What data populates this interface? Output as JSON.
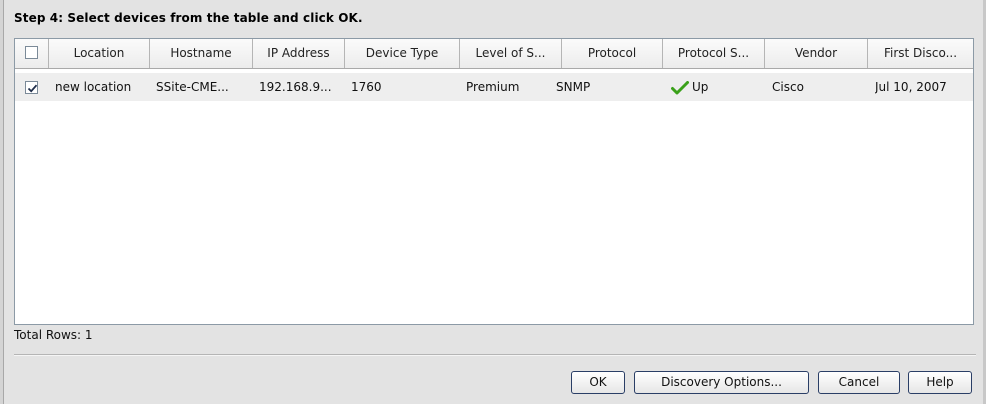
{
  "step_title": "Step 4: Select devices from the table and click OK.",
  "table": {
    "columns": [
      "Location",
      "Hostname",
      "IP Address",
      "Device Type",
      "Level of S...",
      "Protocol",
      "Protocol S...",
      "Vendor",
      "First Disco..."
    ],
    "rows": [
      {
        "checked": true,
        "location": "new location",
        "hostname": "SSite-CME...",
        "ip_address": "192.168.9...",
        "device_type": "1760",
        "level_of_service": "Premium",
        "protocol": "SNMP",
        "protocol_status": "Up",
        "protocol_status_icon": "check-icon",
        "vendor": "Cisco",
        "first_discovered": "Jul 10, 2007"
      }
    ]
  },
  "total_rows": "Total Rows: 1",
  "buttons": {
    "ok": "OK",
    "discovery_options": "Discovery Options...",
    "cancel": "Cancel",
    "help": "Help"
  },
  "colors": {
    "check_green": "#3aa11a",
    "button_border": "#2a3e66",
    "selected_row": "#eeeeee"
  }
}
